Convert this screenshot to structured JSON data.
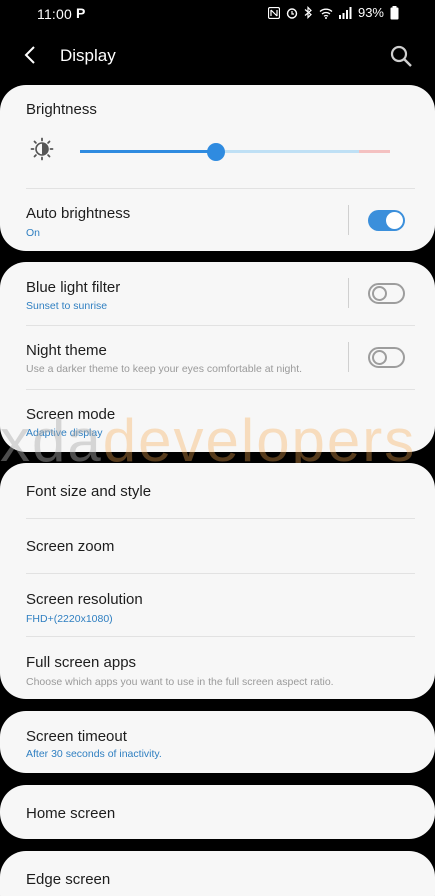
{
  "status_bar": {
    "time": "11:00",
    "p_icon": "P",
    "battery": "93%"
  },
  "app_bar": {
    "title": "Display"
  },
  "brightness": {
    "label": "Brightness",
    "level_fraction": 0.44
  },
  "auto_brightness": {
    "title": "Auto brightness",
    "subtitle": "On",
    "enabled": true
  },
  "blue_light_filter": {
    "title": "Blue light filter",
    "subtitle": "Sunset to sunrise",
    "enabled": false
  },
  "night_theme": {
    "title": "Night theme",
    "subtitle": "Use a darker theme to keep your eyes comfortable at night.",
    "enabled": false
  },
  "screen_mode": {
    "title": "Screen mode",
    "subtitle": "Adaptive display"
  },
  "watermark": {
    "part_a": "xda",
    "part_b": "developers"
  },
  "font_size": {
    "title": "Font size and style"
  },
  "screen_zoom": {
    "title": "Screen zoom"
  },
  "screen_resolution": {
    "title": "Screen resolution",
    "subtitle": "FHD+(2220x1080)"
  },
  "full_screen_apps": {
    "title": "Full screen apps",
    "subtitle": "Choose which apps you want to use in the full screen aspect ratio."
  },
  "screen_timeout": {
    "title": "Screen timeout",
    "subtitle": "After 30 seconds of inactivity."
  },
  "home_screen": {
    "title": "Home screen"
  },
  "edge_screen": {
    "title": "Edge screen"
  },
  "colors": {
    "accent": "#2f8be0",
    "background": "#000000",
    "card": "#f7f7f7"
  }
}
